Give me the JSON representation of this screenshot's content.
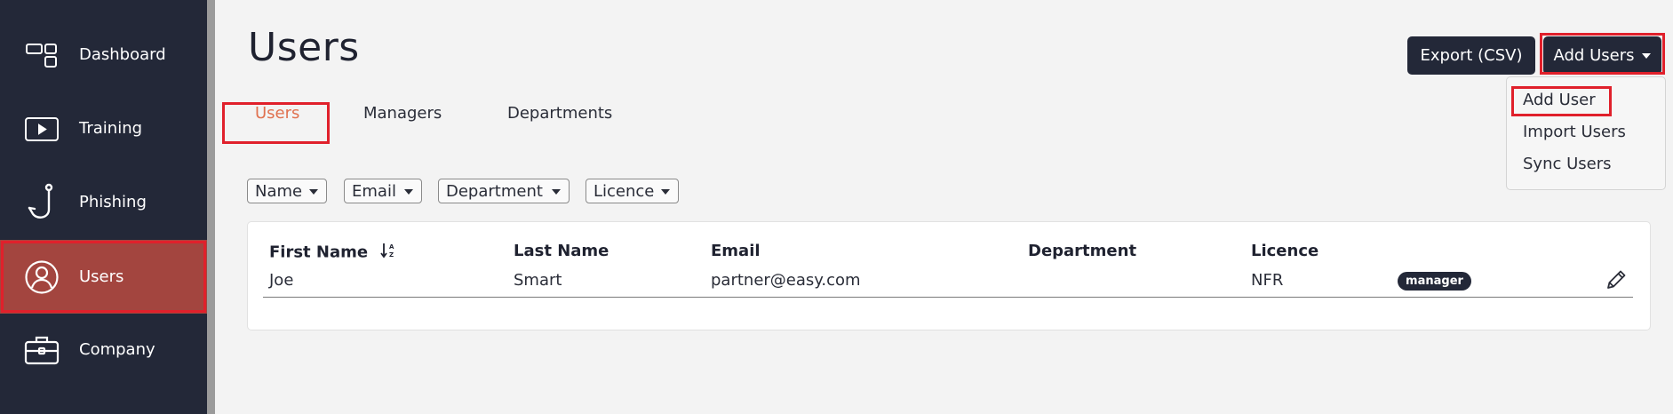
{
  "sidebar": {
    "items": [
      {
        "label": "Dashboard",
        "icon": "dashboard-icon"
      },
      {
        "label": "Training",
        "icon": "play-icon"
      },
      {
        "label": "Phishing",
        "icon": "fishhook-icon"
      },
      {
        "label": "Users",
        "icon": "user-icon",
        "active": true
      },
      {
        "label": "Company",
        "icon": "briefcase-icon"
      }
    ]
  },
  "header": {
    "title": "Users",
    "export_label": "Export (CSV)",
    "add_users_label": "Add Users"
  },
  "add_users_menu": {
    "items": [
      "Add User",
      "Import Users",
      "Sync Users"
    ]
  },
  "tabs": [
    {
      "label": "Users",
      "active": true
    },
    {
      "label": "Managers"
    },
    {
      "label": "Departments"
    }
  ],
  "filters": [
    "Name",
    "Email",
    "Department",
    "Licence"
  ],
  "table": {
    "columns": [
      "First Name",
      "Last Name",
      "Email",
      "Department",
      "Licence"
    ],
    "rows": [
      {
        "first_name": "Joe",
        "last_name": "Smart",
        "email": "partner@easy.com",
        "department": "",
        "licence": "NFR",
        "badge": "manager"
      }
    ]
  },
  "colors": {
    "sidebar_bg": "#232838",
    "active_nav_bg": "#a3453f",
    "highlight_red": "#e0202b",
    "active_tab": "#e0714f",
    "button_dark": "#232838"
  }
}
